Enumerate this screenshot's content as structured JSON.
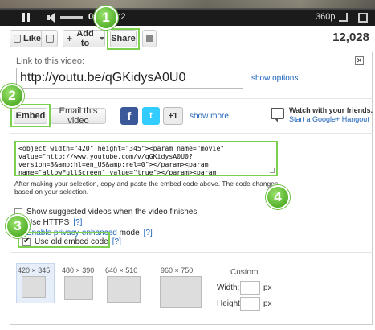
{
  "player": {
    "time_current": "0:22",
    "time_total": "/ 1:2",
    "quality": "360p"
  },
  "actions": {
    "like_label": "Like",
    "add_to_label": "Add to",
    "share_label": "Share",
    "view_count": "12,028"
  },
  "share_panel": {
    "link_label": "Link to this video:",
    "url_value": "http://youtu.be/qGKidysA0U0",
    "show_options": "show options",
    "close": "✕",
    "embed_label": "Embed",
    "email_label": "Email this video",
    "facebook_glyph": "f",
    "twitter_glyph": "t",
    "gplus_glyph": "+1",
    "show_more": "show more",
    "hangout_title": "Watch with your friends.",
    "hangout_link": "Start a Google+ Hangout"
  },
  "embed": {
    "code": "<object width=\"420\" height=\"345\"><param name=\"movie\"\nvalue=\"http://www.youtube.com/v/qGKidysA0U0?\nversion=3&amp;hl=en_US&amp;rel=0\"></param><param\nname=\"allowFullScreen\" value=\"true\"></param><param",
    "hint": "After making your selection, copy and paste the embed code above. The code changes based on your selection.",
    "options": [
      {
        "label": "Show suggested videos when the video finishes",
        "checked": false
      },
      {
        "label": "Use HTTPS",
        "help": "[?]",
        "checked": false
      },
      {
        "label_link": "Enable privacy-enhanced",
        "label": " mode",
        "help": "[?]",
        "checked": false
      },
      {
        "label": "Use old embed code",
        "help": "[?]",
        "checked": true
      }
    ],
    "sizes": [
      "420 × 345",
      "480 × 390",
      "640 × 510",
      "960 × 750"
    ],
    "custom_label": "Custom",
    "width_label": "Width:",
    "height_label": "Height:",
    "px": "px"
  },
  "badges": [
    "1",
    "2",
    "3",
    "4"
  ],
  "colors": {
    "highlight_green": "#7bd050",
    "link_blue": "#1c62b9",
    "facebook_blue": "#3b5998",
    "twitter_blue": "#33ccff"
  }
}
